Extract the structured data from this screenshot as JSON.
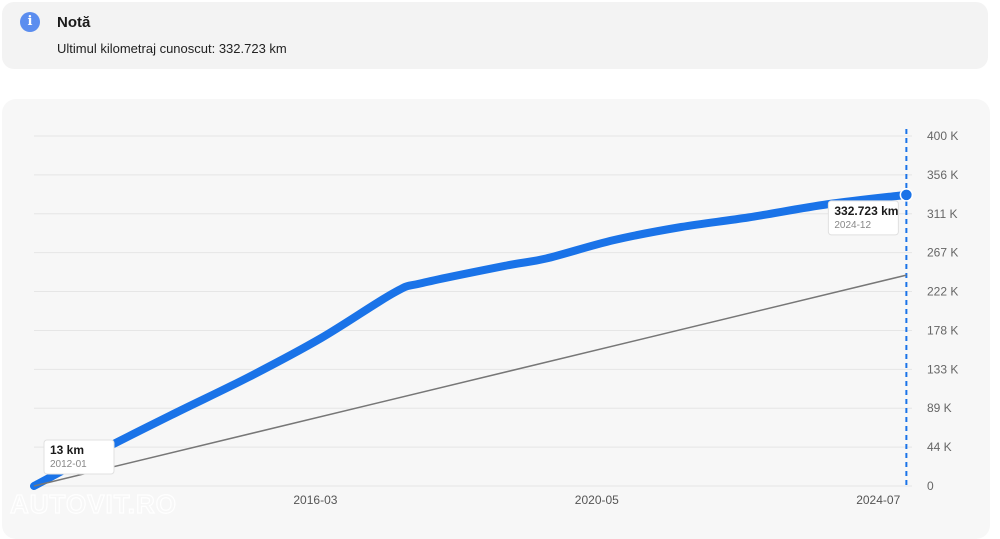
{
  "note": {
    "title": "Notă",
    "text": "Ultimul kilometraj cunoscut: 332.723 km",
    "icon": "info-icon"
  },
  "watermark": "AUTOVIT.RO",
  "chart_data": {
    "type": "line",
    "x_ticks": [
      "2016-03",
      "2020-05",
      "2024-07"
    ],
    "y_ticks": [
      "0",
      "44 K",
      "89 K",
      "133 K",
      "178 K",
      "222 K",
      "267 K",
      "311 K",
      "356 K",
      "400 K"
    ],
    "ylim": [
      0,
      400000
    ],
    "xlim": [
      "2012-01",
      "2025-01"
    ],
    "series": [
      {
        "color": "#1a73e8",
        "points": [
          {
            "x": "2012-01",
            "y": 13
          },
          {
            "x": "2013-01",
            "y": 41000
          },
          {
            "x": "2014-02",
            "y": 83000
          },
          {
            "x": "2015-03",
            "y": 124000
          },
          {
            "x": "2016-04",
            "y": 169000
          },
          {
            "x": "2017-05",
            "y": 221000
          },
          {
            "x": "2017-10",
            "y": 232000
          },
          {
            "x": "2019-01",
            "y": 252000
          },
          {
            "x": "2019-08",
            "y": 260000
          },
          {
            "x": "2020-08",
            "y": 281000
          },
          {
            "x": "2021-08",
            "y": 296000
          },
          {
            "x": "2022-08",
            "y": 307000
          },
          {
            "x": "2023-10",
            "y": 322000
          },
          {
            "x": "2024-12",
            "y": 332723
          }
        ]
      },
      {
        "color": "#777777",
        "points": [
          {
            "x": "2012-01",
            "y": 0
          },
          {
            "x": "2024-12",
            "y": 241000
          }
        ]
      }
    ],
    "annotations": [
      {
        "label": "13 km",
        "date": "2012-01",
        "x": "2012-01",
        "y": 13
      },
      {
        "label": "332.723 km",
        "date": "2024-12",
        "x": "2024-12",
        "y": 332723
      }
    ],
    "marker": {
      "x": "2024-12"
    },
    "grid": true
  }
}
